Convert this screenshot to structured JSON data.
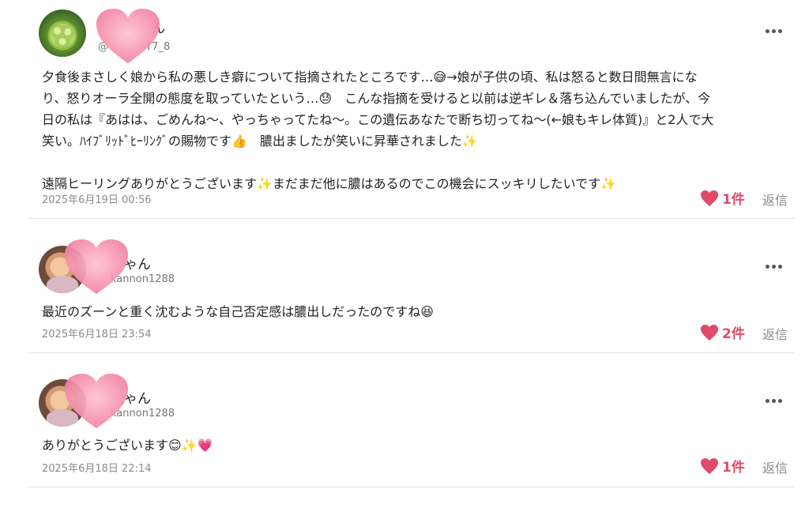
{
  "comments": [
    {
      "name": "ん",
      "handle": "@　　　nT7_8",
      "text_lines": [
        "夕食後まさしく娘から私の悪しき癖について指摘されたところです…😅→娘が子供の頃、私は怒ると数日間無言にな",
        "り、怒りオーラ全開の態度を取っていたという…😓　こんな指摘を受けると以前は逆ギレ＆落ち込んでいましたが、今",
        "日の私は『あはは、ごめんね〜、やっちゃってたね〜。この遺伝あなたで断ち切ってね〜(←娘もキレ体質)』と2人で大",
        "笑い。ﾊｲﾌﾞﾘｯﾄﾞﾋｰﾘﾝｸﾞの賜物です👍　膿出ましたが笑いに昇華されました✨",
        "",
        "遠隔ヒーリングありがとうございます✨まだまだ他に膿はあるのでこの機会にスッキリしたいです✨"
      ],
      "date": "2025年6月19日 00:56",
      "likes": "1件",
      "reply": "返信",
      "avatar": "grapes-avatar"
    },
    {
      "name": "ゃん",
      "handle": "kannon1288",
      "text_lines": [
        "最近のズーンと重く沈むような自己否定感は膿出しだったのですね😆"
      ],
      "date": "2025年6月18日 23:54",
      "likes": "2件",
      "reply": "返信",
      "avatar": "person-avatar"
    },
    {
      "name": "ゃん",
      "handle": "kannon1288",
      "text_lines": [
        "ありがとうございます😊✨💗"
      ],
      "date": "2025年6月18日 22:14",
      "likes": "1件",
      "reply": "返信",
      "avatar": "person-avatar"
    }
  ],
  "colors": {
    "like": "#e04b6a",
    "heart_overlay": "#f48aa8",
    "muted": "#8a8a8a"
  },
  "icons": {
    "more": "more-options-icon",
    "like": "heart-icon",
    "overlay": "heart-sticker-icon"
  }
}
